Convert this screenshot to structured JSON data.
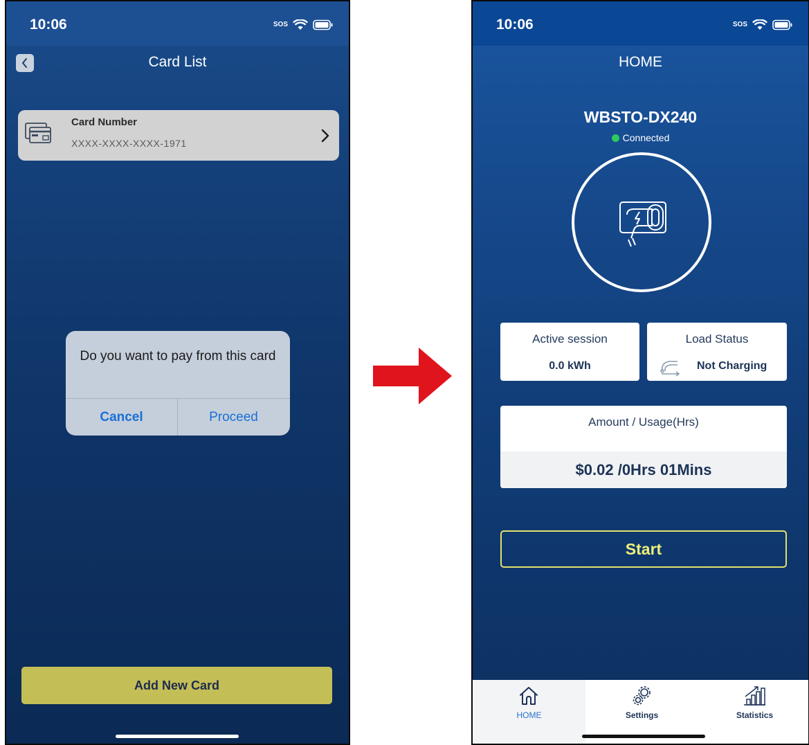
{
  "left_screen": {
    "status": {
      "time": "10:06",
      "sos": "SOS"
    },
    "nav": {
      "title": "Card List"
    },
    "card": {
      "label": "Card Number",
      "number": "XXXX-XXXX-XXXX-1971"
    },
    "dialog": {
      "message": "Do you want to pay from this card",
      "cancel_label": "Cancel",
      "proceed_label": "Proceed"
    },
    "add_card_label": "Add New Card"
  },
  "right_screen": {
    "status": {
      "time": "10:06",
      "sos": "SOS"
    },
    "nav": {
      "title": "HOME"
    },
    "device": {
      "name": "WBSTO-DX240",
      "status": "Connected"
    },
    "active_session": {
      "title": "Active session",
      "value": "0.0 kWh"
    },
    "load_status": {
      "title": "Load Status",
      "value": "Not Charging"
    },
    "amount": {
      "title": "Amount / Usage(Hrs)",
      "value": "$0.02 /0Hrs 01Mins"
    },
    "start_label": "Start",
    "tabs": [
      {
        "label": "HOME",
        "icon": "home-icon",
        "active": true
      },
      {
        "label": "Settings",
        "icon": "gear-icon",
        "active": false
      },
      {
        "label": "Statistics",
        "icon": "statistics-icon",
        "active": false
      }
    ]
  },
  "colors": {
    "accent_yellow": "#e4e06a",
    "add_card_button": "#c4be56",
    "connected_dot": "#2ec95c",
    "dialog_link": "#1a6fd6",
    "arrow": "#e0141c"
  }
}
